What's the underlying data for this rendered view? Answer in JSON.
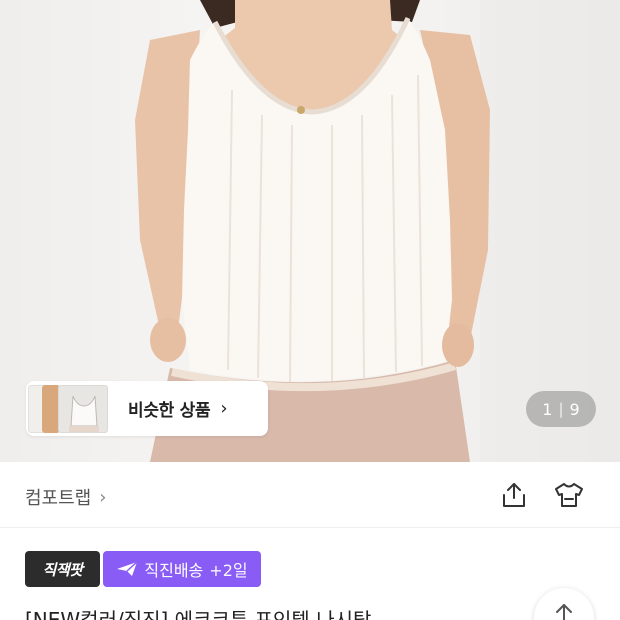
{
  "gallery": {
    "current_index": "1",
    "total": "9",
    "separator": "|",
    "similar_products_label": "비슷한 상품",
    "similar_chevron": "›"
  },
  "brand": {
    "name": "컴포트랩",
    "chevron": "›"
  },
  "badges": {
    "zigzag_label": "직잭팟",
    "direct_delivery_label": "직진배송",
    "delivery_extra": "+2일",
    "direct_color": "#8a5cf6"
  },
  "product": {
    "title": "[NEW컬러/직진] 에코코튼 포인텔 나시탑"
  },
  "icons": {
    "share": "share-icon",
    "shirt_compare": "shirt-icon",
    "scroll_top": "arrow-up-icon"
  }
}
